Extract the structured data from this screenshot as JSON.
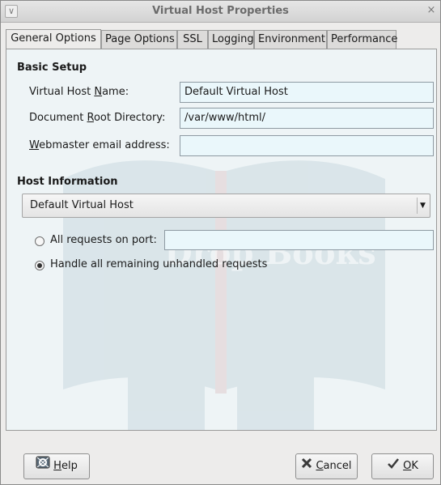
{
  "window": {
    "title": "Virtual Host Properties",
    "menu_glyph": "∨",
    "close_glyph": "×"
  },
  "tabs": [
    {
      "label": "General Options",
      "active": true
    },
    {
      "label": "Page Options",
      "active": false
    },
    {
      "label": "SSL",
      "active": false
    },
    {
      "label": "Logging",
      "active": false
    },
    {
      "label": "Environment",
      "active": false
    },
    {
      "label": "Performance",
      "active": false
    }
  ],
  "basic_setup": {
    "title": "Basic Setup",
    "vhost_name": {
      "label_before": "Virtual Host ",
      "label_mnemonic": "N",
      "label_after": "ame:",
      "value": "Default Virtual Host"
    },
    "doc_root": {
      "label_before": "Document ",
      "label_mnemonic": "R",
      "label_after": "oot Directory:",
      "value": "/var/www/html/"
    },
    "webmaster": {
      "label_before": "",
      "label_mnemonic": "W",
      "label_after": "ebmaster email address:",
      "value": ""
    }
  },
  "host_info": {
    "title": "Host Information",
    "combo_value": "Default Virtual Host",
    "radio_all_port": {
      "label": "All requests on port:",
      "checked": false,
      "port_value": ""
    },
    "radio_unhandled": {
      "label": "Handle all remaining unhandled requests",
      "checked": true
    }
  },
  "buttons": {
    "help": {
      "mnemonic": "H",
      "rest": "elp"
    },
    "cancel": {
      "mnemonic": "C",
      "rest": "ancel"
    },
    "ok": {
      "mnemonic": "O",
      "rest": "K"
    }
  },
  "watermark": {
    "text": "Drop Books"
  },
  "icons": {
    "menu": "chevron-down-icon",
    "close": "close-icon",
    "combo_arrow": "dropdown-arrow-icon",
    "help": "help-icon",
    "cancel": "cancel-icon",
    "ok": "ok-check-icon"
  },
  "colors": {
    "entry_bg": "#eaf7fb",
    "window_bg": "#edeceb",
    "watermark_book": "#4e7f93",
    "watermark_accent": "#b44a4a"
  }
}
